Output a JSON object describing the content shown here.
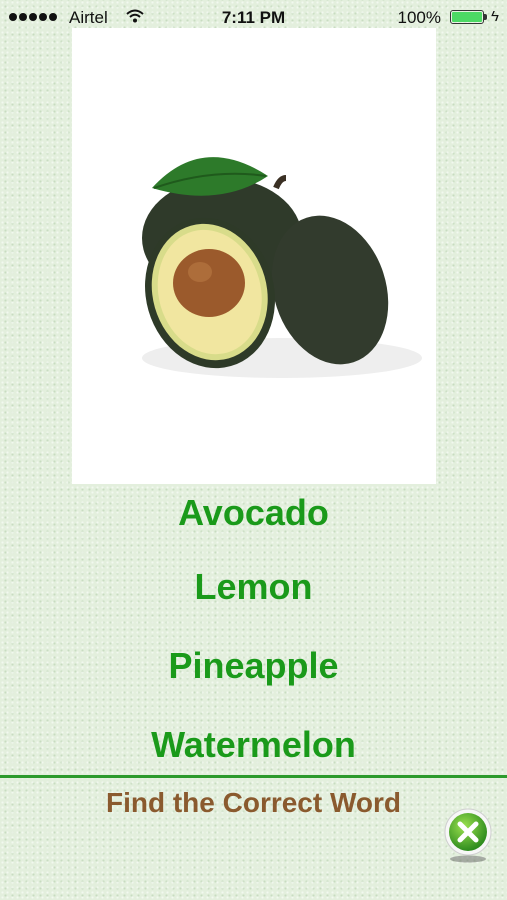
{
  "status_bar": {
    "carrier": "Airtel",
    "time": "7:11 PM",
    "battery_percent": "100%",
    "battery_color": "#4cd964"
  },
  "quiz": {
    "image_icon": "avocado-image",
    "options": [
      {
        "label": "Avocado"
      },
      {
        "label": "Lemon"
      },
      {
        "label": "Pineapple"
      },
      {
        "label": "Watermelon"
      }
    ],
    "option_color": "#1a9a1a",
    "instruction": "Find the Correct Word",
    "instruction_color": "#8a5a2e",
    "close_icon": "close-icon"
  }
}
